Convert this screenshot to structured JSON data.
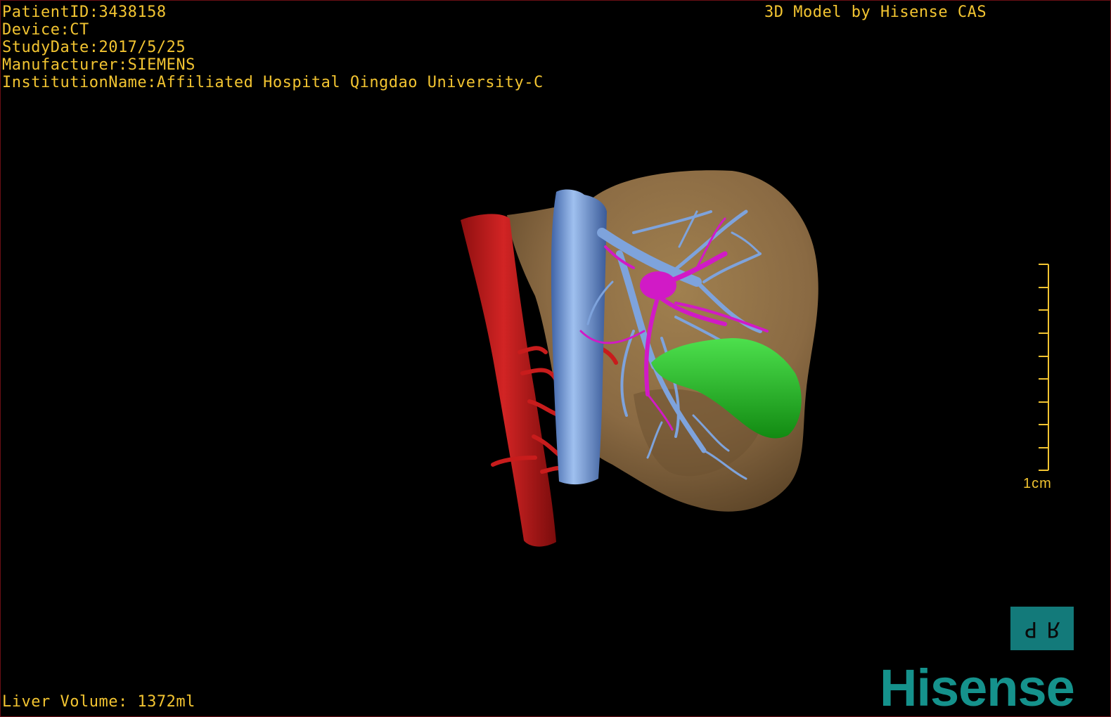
{
  "study_info": {
    "patient_id": "PatientID:3438158",
    "device": "Device:CT",
    "study_date": "StudyDate:2017/5/25",
    "manufacturer": "Manufacturer:SIEMENS",
    "institution": "InstitutionName:Affiliated Hospital Qingdao University-C"
  },
  "credit": "3D Model by Hisense CAS",
  "liver_volume": "Liver Volume: 1372ml",
  "scale_bar": {
    "label": "1cm"
  },
  "orientation_cube": {
    "letter_left": "P",
    "letter_right": "R"
  },
  "brand": "Hisense",
  "colors": {
    "text": "#f2c431",
    "background": "#000000",
    "liver": "#8a6a43",
    "aorta": "#c81c1c",
    "vena_cava": "#6f98d8",
    "hepatic_veins": "#7ea3dc",
    "portal_vein": "#d11ac6",
    "gallbladder": "#1ec01e",
    "cube": "#137a7a",
    "brand": "#15928c"
  }
}
